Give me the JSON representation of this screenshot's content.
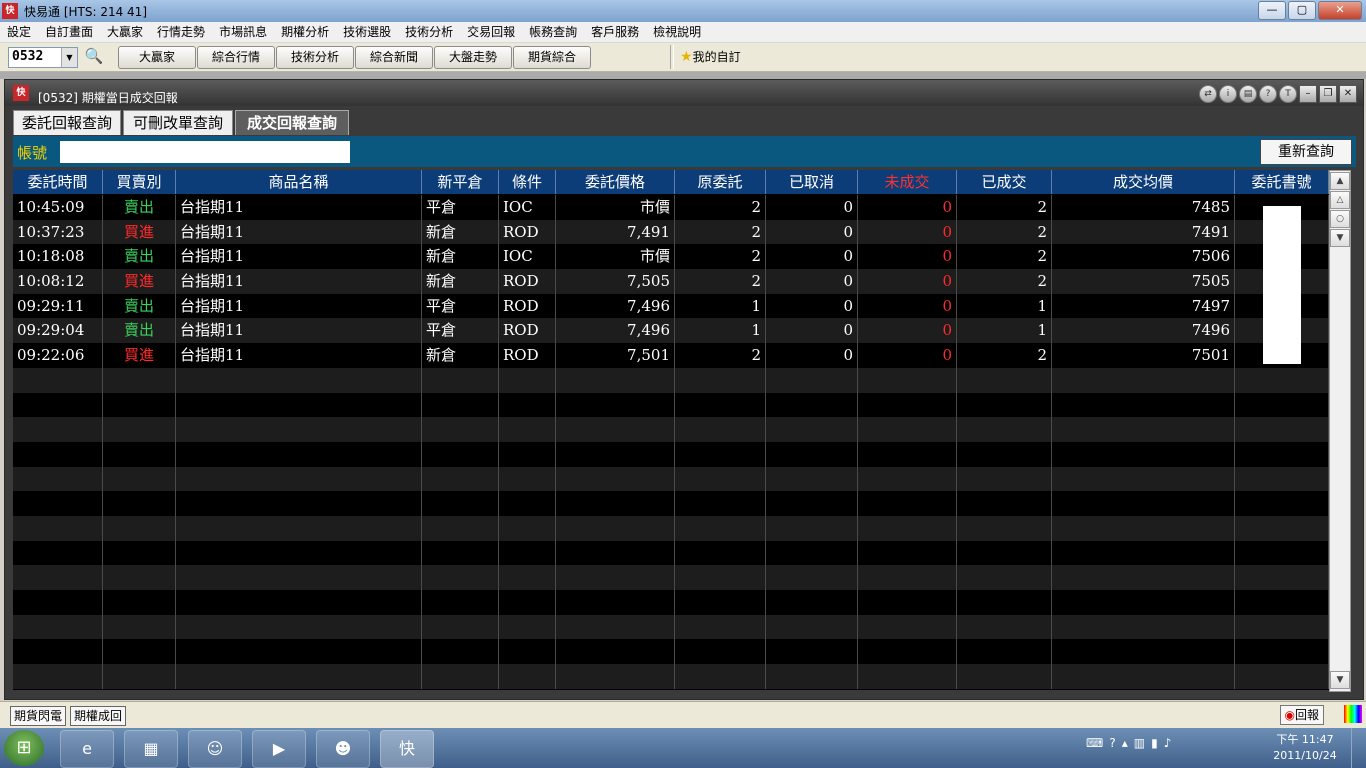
{
  "window": {
    "title": "快易通  [HTS: 214 41]",
    "min": "—",
    "max": "▢",
    "close": "✕"
  },
  "menu": [
    "設定",
    "自訂畫面",
    "大贏家",
    "行情走勢",
    "市場訊息",
    "期權分析",
    "技術選股",
    "技術分析",
    "交易回報",
    "帳務查詢",
    "客戶服務",
    "檢視說明"
  ],
  "toolbar": {
    "code": "0532",
    "buttons": [
      "大贏家",
      "綜合行情",
      "技術分析",
      "綜合新聞",
      "大盤走勢",
      "期貨綜合"
    ],
    "favorite": "我的自訂"
  },
  "inner": {
    "title": "[0532] 期權當日成交回報"
  },
  "tabs": [
    "委託回報查詢",
    "可刪改單查詢",
    "成交回報查詢"
  ],
  "account": {
    "label": "帳號",
    "requery": "重新查詢"
  },
  "table": {
    "headers": [
      "委託時間",
      "買賣別",
      "商品名稱",
      "新平倉",
      "條件",
      "委託價格",
      "原委託",
      "已取消",
      "未成交",
      "已成交",
      "成交均價",
      "委託書號"
    ],
    "rows": [
      {
        "time": "10:45:09",
        "side": "賣出",
        "product": "台指期11",
        "pos": "平倉",
        "cond": "IOC",
        "price": "市價",
        "orig": "2",
        "cancel": "0",
        "unfilled": "0",
        "filled": "2",
        "avg": "7485"
      },
      {
        "time": "10:37:23",
        "side": "買進",
        "product": "台指期11",
        "pos": "新倉",
        "cond": "ROD",
        "price": "7,491",
        "orig": "2",
        "cancel": "0",
        "unfilled": "0",
        "filled": "2",
        "avg": "7491"
      },
      {
        "time": "10:18:08",
        "side": "賣出",
        "product": "台指期11",
        "pos": "新倉",
        "cond": "IOC",
        "price": "市價",
        "orig": "2",
        "cancel": "0",
        "unfilled": "0",
        "filled": "2",
        "avg": "7506"
      },
      {
        "time": "10:08:12",
        "side": "買進",
        "product": "台指期11",
        "pos": "新倉",
        "cond": "ROD",
        "price": "7,505",
        "orig": "2",
        "cancel": "0",
        "unfilled": "0",
        "filled": "2",
        "avg": "7505"
      },
      {
        "time": "09:29:11",
        "side": "賣出",
        "product": "台指期11",
        "pos": "平倉",
        "cond": "ROD",
        "price": "7,496",
        "orig": "1",
        "cancel": "0",
        "unfilled": "0",
        "filled": "1",
        "avg": "7497"
      },
      {
        "time": "09:29:04",
        "side": "賣出",
        "product": "台指期11",
        "pos": "平倉",
        "cond": "ROD",
        "price": "7,496",
        "orig": "1",
        "cancel": "0",
        "unfilled": "0",
        "filled": "1",
        "avg": "7496"
      },
      {
        "time": "09:22:06",
        "side": "買進",
        "product": "台指期11",
        "pos": "新倉",
        "cond": "ROD",
        "price": "7,501",
        "orig": "2",
        "cancel": "0",
        "unfilled": "0",
        "filled": "2",
        "avg": "7501"
      }
    ]
  },
  "bottom": {
    "tabs": [
      "期貨閃電",
      "期權成回"
    ],
    "back": "回報"
  },
  "taskbar": {
    "time": "下午 11:47",
    "date": "2011/10/24"
  },
  "colors": {
    "sell": "#3bd05b",
    "buy": "#ff2a2a",
    "header_bg": "#0d3d78",
    "account_bar": "#0a5880"
  }
}
